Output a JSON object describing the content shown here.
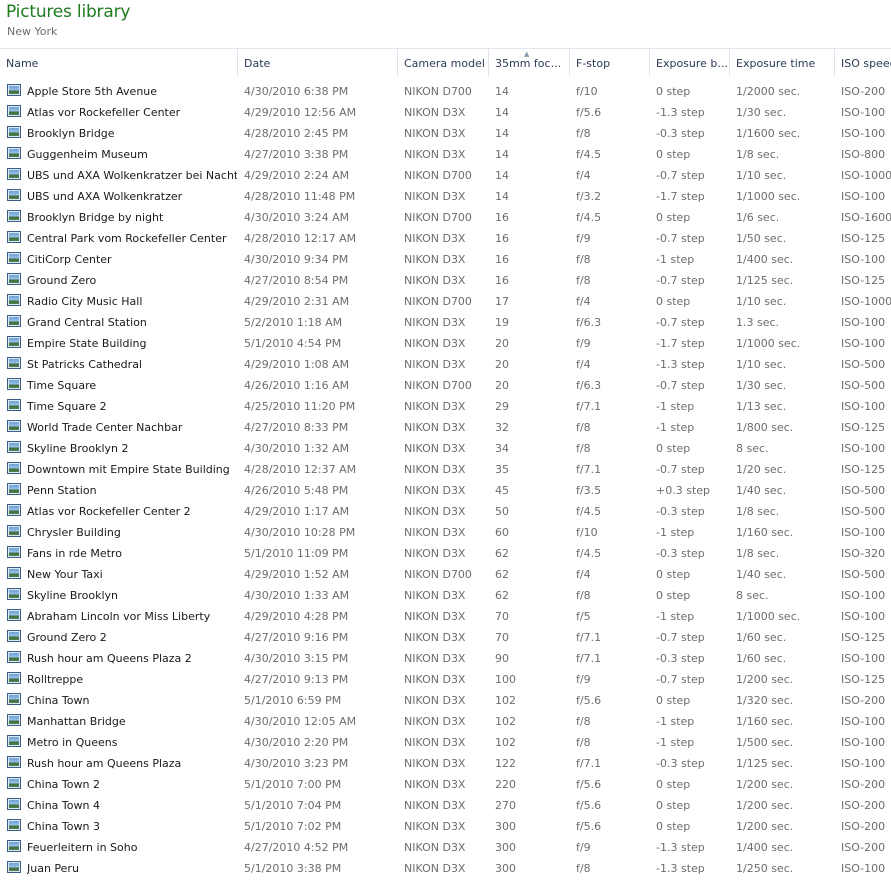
{
  "library": {
    "title": "Pictures library",
    "subtitle": "New York"
  },
  "columns": [
    {
      "key": "name",
      "label": "Name"
    },
    {
      "key": "date",
      "label": "Date"
    },
    {
      "key": "camera",
      "label": "Camera model"
    },
    {
      "key": "focal",
      "label": "35mm foc..."
    },
    {
      "key": "fstop",
      "label": "F-stop"
    },
    {
      "key": "expbias",
      "label": "Exposure b..."
    },
    {
      "key": "exptime",
      "label": "Exposure time"
    },
    {
      "key": "iso",
      "label": "ISO speed"
    }
  ],
  "sorted_column": "focal",
  "icons": {
    "file": "picture-file-icon",
    "sort": "sort-ascending-icon"
  },
  "colors": {
    "title": "#1e7b1e",
    "text": "#1a1a1a",
    "muted": "#6d6d6d"
  },
  "rows": [
    [
      "Apple Store 5th Avenue",
      "4/30/2010 6:38 PM",
      "NIKON D700",
      "14",
      "f/10",
      "0 step",
      "1/2000 sec.",
      "ISO-200"
    ],
    [
      "Atlas vor Rockefeller Center",
      "4/29/2010 12:56 AM",
      "NIKON D3X",
      "14",
      "f/5.6",
      "-1.3 step",
      "1/30 sec.",
      "ISO-100"
    ],
    [
      "Brooklyn Bridge",
      "4/28/2010 2:45 PM",
      "NIKON D3X",
      "14",
      "f/8",
      "-0.3 step",
      "1/1600 sec.",
      "ISO-100"
    ],
    [
      "Guggenheim Museum",
      "4/27/2010 3:38 PM",
      "NIKON D3X",
      "14",
      "f/4.5",
      "0 step",
      "1/8 sec.",
      "ISO-800"
    ],
    [
      "UBS und AXA Wolkenkratzer bei Nacht",
      "4/29/2010 2:24 AM",
      "NIKON D700",
      "14",
      "f/4",
      "-0.7 step",
      "1/10 sec.",
      "ISO-1000"
    ],
    [
      "UBS und AXA Wolkenkratzer",
      "4/28/2010 11:48 PM",
      "NIKON D3X",
      "14",
      "f/3.2",
      "-1.7 step",
      "1/1000 sec.",
      "ISO-100"
    ],
    [
      "Brooklyn Bridge by night",
      "4/30/2010 3:24 AM",
      "NIKON D700",
      "16",
      "f/4.5",
      "0 step",
      "1/6 sec.",
      "ISO-1600"
    ],
    [
      "Central Park vom Rockefeller Center",
      "4/28/2010 12:17 AM",
      "NIKON D3X",
      "16",
      "f/9",
      "-0.7 step",
      "1/50 sec.",
      "ISO-125"
    ],
    [
      "CitiCorp Center",
      "4/30/2010 9:34 PM",
      "NIKON D3X",
      "16",
      "f/8",
      "-1 step",
      "1/400 sec.",
      "ISO-100"
    ],
    [
      "Ground Zero",
      "4/27/2010 8:54 PM",
      "NIKON D3X",
      "16",
      "f/8",
      "-0.7 step",
      "1/125 sec.",
      "ISO-125"
    ],
    [
      "Radio City Music Hall",
      "4/29/2010 2:31 AM",
      "NIKON D700",
      "17",
      "f/4",
      "0 step",
      "1/10 sec.",
      "ISO-1000"
    ],
    [
      "Grand Central Station",
      "5/2/2010 1:18 AM",
      "NIKON D3X",
      "19",
      "f/6.3",
      "-0.7 step",
      "1.3 sec.",
      "ISO-100"
    ],
    [
      "Empire State Building",
      "5/1/2010 4:54 PM",
      "NIKON D3X",
      "20",
      "f/9",
      "-1.7 step",
      "1/1000 sec.",
      "ISO-100"
    ],
    [
      "St Patricks Cathedral",
      "4/29/2010 1:08 AM",
      "NIKON D3X",
      "20",
      "f/4",
      "-1.3 step",
      "1/10 sec.",
      "ISO-500"
    ],
    [
      "Time Square",
      "4/26/2010 1:16 AM",
      "NIKON D700",
      "20",
      "f/6.3",
      "-0.7 step",
      "1/30 sec.",
      "ISO-500"
    ],
    [
      "Time Square 2",
      "4/25/2010 11:20 PM",
      "NIKON D3X",
      "29",
      "f/7.1",
      "-1 step",
      "1/13 sec.",
      "ISO-100"
    ],
    [
      "World Trade Center Nachbar",
      "4/27/2010 8:33 PM",
      "NIKON D3X",
      "32",
      "f/8",
      "-1 step",
      "1/800 sec.",
      "ISO-125"
    ],
    [
      "Skyline Brooklyn 2",
      "4/30/2010 1:32 AM",
      "NIKON D3X",
      "34",
      "f/8",
      "0 step",
      "8 sec.",
      "ISO-100"
    ],
    [
      "Downtown mit Empire State Building",
      "4/28/2010 12:37 AM",
      "NIKON D3X",
      "35",
      "f/7.1",
      "-0.7 step",
      "1/20 sec.",
      "ISO-125"
    ],
    [
      "Penn Station",
      "4/26/2010 5:48 PM",
      "NIKON D3X",
      "45",
      "f/3.5",
      "+0.3 step",
      "1/40 sec.",
      "ISO-500"
    ],
    [
      "Atlas vor Rockefeller Center 2",
      "4/29/2010 1:17 AM",
      "NIKON D3X",
      "50",
      "f/4.5",
      "-0.3 step",
      "1/8 sec.",
      "ISO-500"
    ],
    [
      "Chrysler Building",
      "4/30/2010 10:28 PM",
      "NIKON D3X",
      "60",
      "f/10",
      "-1 step",
      "1/160 sec.",
      "ISO-100"
    ],
    [
      "Fans in rde Metro",
      "5/1/2010 11:09 PM",
      "NIKON D3X",
      "62",
      "f/4.5",
      "-0.3 step",
      "1/8 sec.",
      "ISO-320"
    ],
    [
      "New Your Taxi",
      "4/29/2010 1:52 AM",
      "NIKON D700",
      "62",
      "f/4",
      "0 step",
      "1/40 sec.",
      "ISO-500"
    ],
    [
      "Skyline Brooklyn",
      "4/30/2010 1:33 AM",
      "NIKON D3X",
      "62",
      "f/8",
      "0 step",
      "8 sec.",
      "ISO-100"
    ],
    [
      "Abraham Lincoln vor Miss Liberty",
      "4/29/2010 4:28 PM",
      "NIKON D3X",
      "70",
      "f/5",
      "-1 step",
      "1/1000 sec.",
      "ISO-100"
    ],
    [
      "Ground Zero 2",
      "4/27/2010 9:16 PM",
      "NIKON D3X",
      "70",
      "f/7.1",
      "-0.7 step",
      "1/60 sec.",
      "ISO-125"
    ],
    [
      "Rush hour am Queens Plaza 2",
      "4/30/2010 3:15 PM",
      "NIKON D3X",
      "90",
      "f/7.1",
      "-0.3 step",
      "1/60 sec.",
      "ISO-100"
    ],
    [
      "Rolltreppe",
      "4/27/2010 9:13 PM",
      "NIKON D3X",
      "100",
      "f/9",
      "-0.7 step",
      "1/200 sec.",
      "ISO-125"
    ],
    [
      "China Town",
      "5/1/2010 6:59 PM",
      "NIKON D3X",
      "102",
      "f/5.6",
      "0 step",
      "1/320 sec.",
      "ISO-200"
    ],
    [
      "Manhattan Bridge",
      "4/30/2010 12:05 AM",
      "NIKON D3X",
      "102",
      "f/8",
      "-1 step",
      "1/160 sec.",
      "ISO-100"
    ],
    [
      "Metro in Queens",
      "4/30/2010 2:20 PM",
      "NIKON D3X",
      "102",
      "f/8",
      "-1 step",
      "1/500 sec.",
      "ISO-100"
    ],
    [
      "Rush hour am Queens Plaza",
      "4/30/2010 3:23 PM",
      "NIKON D3X",
      "122",
      "f/7.1",
      "-0.3 step",
      "1/125 sec.",
      "ISO-100"
    ],
    [
      "China Town 2",
      "5/1/2010 7:00 PM",
      "NIKON D3X",
      "220",
      "f/5.6",
      "0 step",
      "1/200 sec.",
      "ISO-200"
    ],
    [
      "China Town 4",
      "5/1/2010 7:04 PM",
      "NIKON D3X",
      "270",
      "f/5.6",
      "0 step",
      "1/200 sec.",
      "ISO-200"
    ],
    [
      "China Town 3",
      "5/1/2010 7:02 PM",
      "NIKON D3X",
      "300",
      "f/5.6",
      "0 step",
      "1/200 sec.",
      "ISO-200"
    ],
    [
      "Feuerleitern in Soho",
      "4/27/2010 4:52 PM",
      "NIKON D3X",
      "300",
      "f/9",
      "-1.3 step",
      "1/400 sec.",
      "ISO-200"
    ],
    [
      "Juan Peru",
      "5/1/2010 3:38 PM",
      "NIKON D3X",
      "300",
      "f/8",
      "-1.3 step",
      "1/250 sec.",
      "ISO-100"
    ]
  ]
}
